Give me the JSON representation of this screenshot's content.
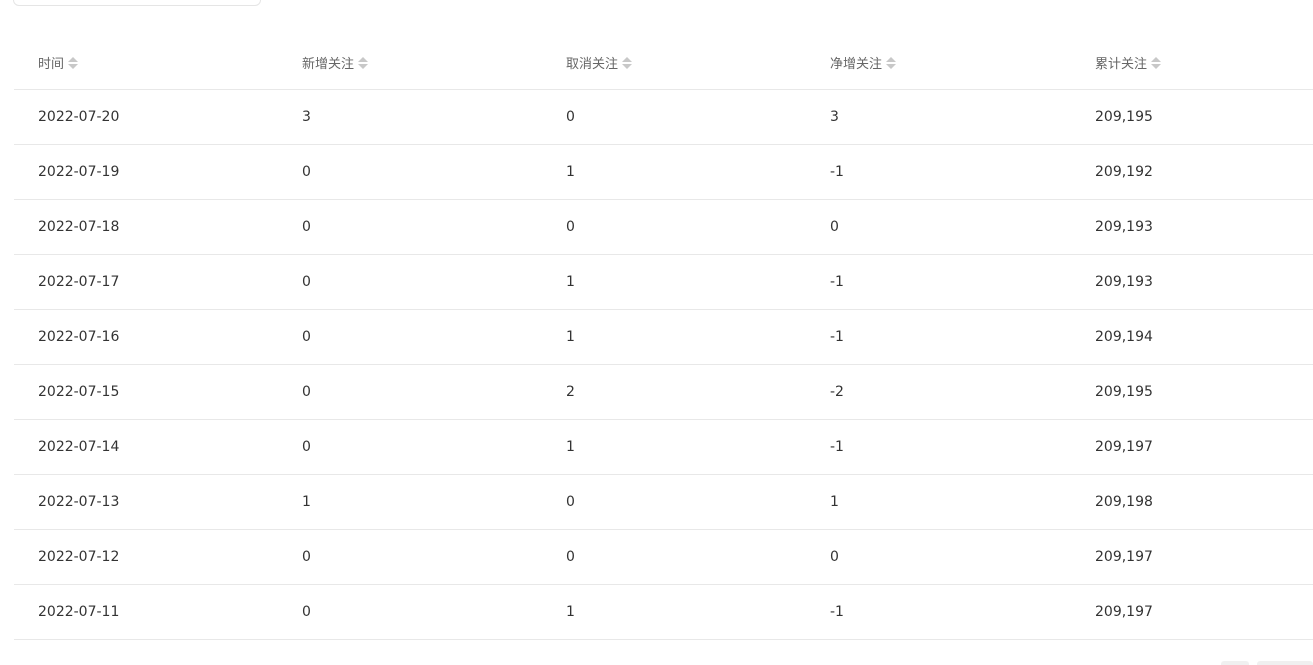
{
  "table": {
    "headers": [
      "时间",
      "新增关注",
      "取消关注",
      "净增关注",
      "累计关注"
    ],
    "rows": [
      [
        "2022-07-20",
        "3",
        "0",
        "3",
        "209,195"
      ],
      [
        "2022-07-19",
        "0",
        "1",
        "-1",
        "209,192"
      ],
      [
        "2022-07-18",
        "0",
        "0",
        "0",
        "209,193"
      ],
      [
        "2022-07-17",
        "0",
        "1",
        "-1",
        "209,193"
      ],
      [
        "2022-07-16",
        "0",
        "1",
        "-1",
        "209,194"
      ],
      [
        "2022-07-15",
        "0",
        "2",
        "-2",
        "209,195"
      ],
      [
        "2022-07-14",
        "0",
        "1",
        "-1",
        "209,197"
      ],
      [
        "2022-07-13",
        "1",
        "0",
        "1",
        "209,198"
      ],
      [
        "2022-07-12",
        "0",
        "0",
        "0",
        "209,197"
      ],
      [
        "2022-07-11",
        "0",
        "1",
        "-1",
        "209,197"
      ]
    ]
  },
  "icons": {
    "sort": "sort-caret-icon"
  }
}
